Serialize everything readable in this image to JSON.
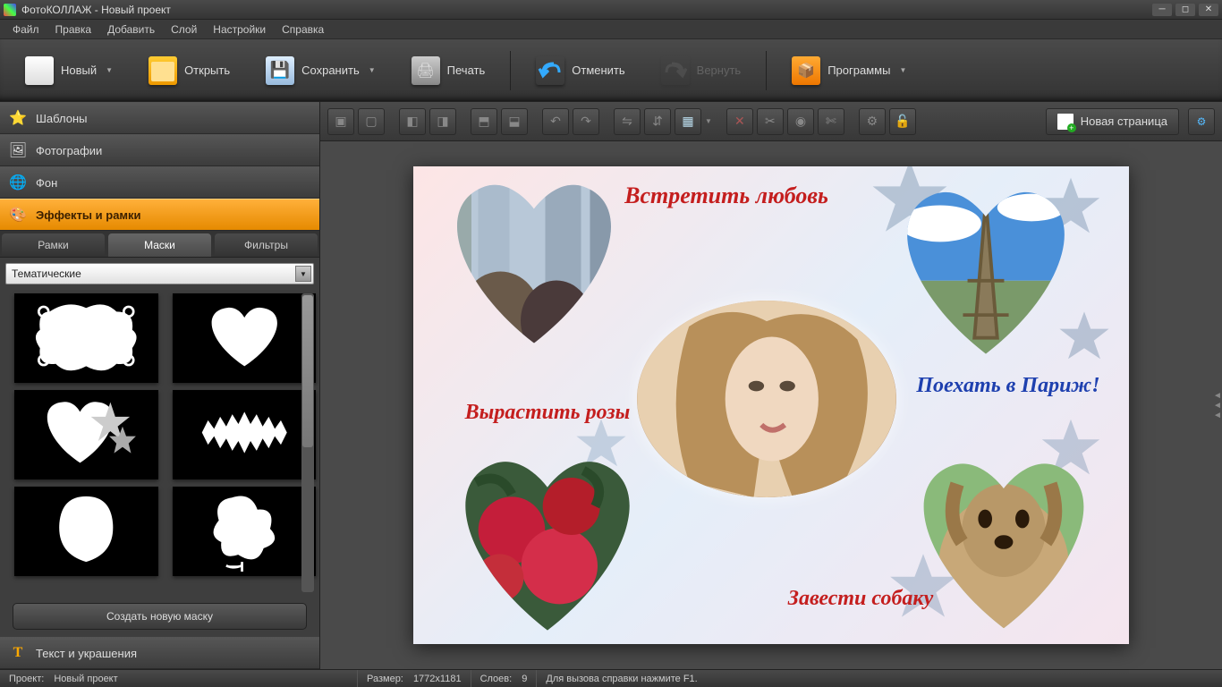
{
  "title": "ФотоКОЛЛАЖ - Новый проект",
  "menu": [
    "Файл",
    "Правка",
    "Добавить",
    "Слой",
    "Настройки",
    "Справка"
  ],
  "toolbar": {
    "new": "Новый",
    "open": "Открыть",
    "save": "Сохранить",
    "print": "Печать",
    "undo": "Отменить",
    "redo": "Вернуть",
    "programs": "Программы"
  },
  "sidebar": {
    "templates": "Шаблоны",
    "photos": "Фотографии",
    "background": "Фон",
    "effects": "Эффекты и рамки",
    "text": "Текст и украшения"
  },
  "tabs": {
    "frames": "Рамки",
    "masks": "Маски",
    "filters": "Фильтры"
  },
  "combo": "Тематические",
  "create_mask": "Создать новую маску",
  "new_page": "Новая страница",
  "collage": {
    "t1": "Встретить любовь",
    "t2": "Поехать в Париж!",
    "t3": "Вырастить розы",
    "t4": "Завести собаку"
  },
  "status": {
    "project_lbl": "Проект:",
    "project": "Новый проект",
    "size_lbl": "Размер:",
    "size": "1772x1181",
    "layers_lbl": "Слоев:",
    "layers": "9",
    "help": "Для вызова справки нажмите F1."
  }
}
